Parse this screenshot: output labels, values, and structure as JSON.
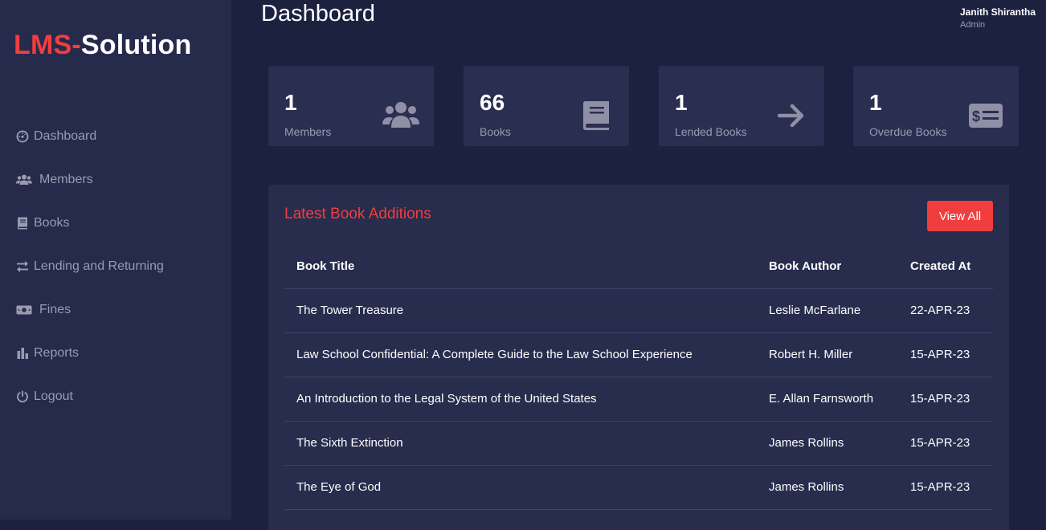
{
  "logo": {
    "part1": "LMS-",
    "part2": "Solution"
  },
  "sidebar": {
    "items": [
      {
        "label": "Dashboard",
        "icon": "tachometer-icon"
      },
      {
        "label": "Members",
        "icon": "users-icon"
      },
      {
        "label": "Books",
        "icon": "book-icon"
      },
      {
        "label": "Lending and Returning",
        "icon": "exchange-icon"
      },
      {
        "label": "Fines",
        "icon": "money-bill-icon"
      },
      {
        "label": "Reports",
        "icon": "bar-chart-icon"
      },
      {
        "label": "Logout",
        "icon": "power-icon"
      }
    ]
  },
  "header": {
    "title": "Dashboard",
    "user_name": "Janith Shirantha",
    "user_role": "Admin"
  },
  "stats": [
    {
      "value": "1",
      "label": "Members",
      "icon": "users-icon"
    },
    {
      "value": "66",
      "label": "Books",
      "icon": "book-icon"
    },
    {
      "value": "1",
      "label": "Lended Books",
      "icon": "arrow-right-icon"
    },
    {
      "value": "1",
      "label": "Overdue Books",
      "icon": "money-check-icon"
    }
  ],
  "latest": {
    "title": "Latest Book Additions",
    "view_all_label": "View All",
    "columns": [
      "Book Title",
      "Book Author",
      "Created At"
    ],
    "rows": [
      [
        "The Tower Treasure",
        "Leslie McFarlane",
        "22-APR-23"
      ],
      [
        "Law School Confidential: A Complete Guide to the Law School Experience",
        "Robert H. Miller",
        "15-APR-23"
      ],
      [
        "An Introduction to the Legal System of the United States",
        "E. Allan Farnsworth",
        "15-APR-23"
      ],
      [
        "The Sixth Extinction",
        "James Rollins",
        "15-APR-23"
      ],
      [
        "The Eye of God",
        "James Rollins",
        "15-APR-23"
      ]
    ]
  },
  "colors": {
    "accent": "#f03e3e",
    "sidebar_bg": "#262a4b",
    "main_bg": "#1d2140",
    "card_bg": "#2a2e50"
  }
}
